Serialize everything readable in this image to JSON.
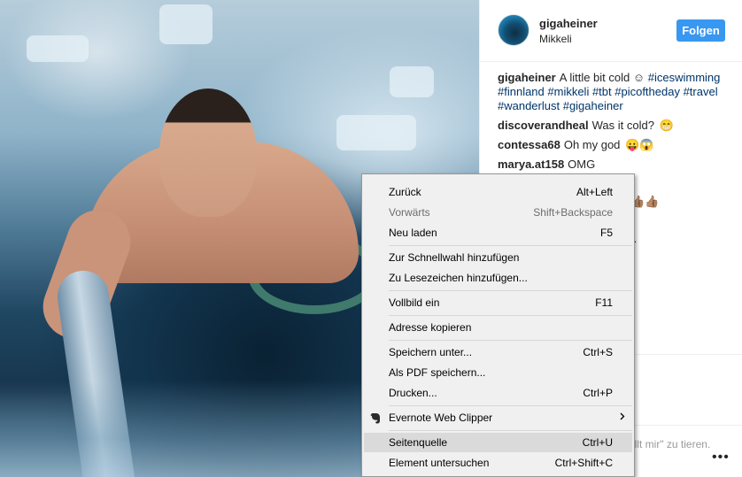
{
  "post": {
    "username": "gigaheiner",
    "location": "Mikkeli",
    "follow_label": "Folgen",
    "caption": {
      "user": "gigaheiner",
      "text": "A little bit cold ☺",
      "hashtags_line1": "#iceswimming",
      "hashtags_line2": "#finnland #mikkeli #tbt #picoftheday #travel",
      "hashtags_line3": "#wanderlust #gigaheiner"
    },
    "comments": [
      {
        "user": "discoverandheal",
        "text": "Was it cold?",
        "emoji": "😁"
      },
      {
        "user": "contessa68",
        "text": "Oh my god",
        "emoji": "😛😱"
      },
      {
        "user": "marya.at158",
        "text": "OMG",
        "emoji": ""
      }
    ],
    "partial_comment_emoji": "👍🏽👍🏽",
    "partial_comment_text": "r.",
    "likes_hint": "ällt mir\" zu tieren.",
    "more_icon": "•••"
  },
  "context_menu": {
    "items": [
      {
        "label": "Zurück",
        "shortcut": "Alt+Left",
        "disabled": false
      },
      {
        "label": "Vorwärts",
        "shortcut": "Shift+Backspace",
        "disabled": true
      },
      {
        "label": "Neu laden",
        "shortcut": "F5",
        "disabled": false
      },
      {
        "label": "Zur Schnellwahl hinzufügen",
        "shortcut": "",
        "disabled": false
      },
      {
        "label": "Zu Lesezeichen hinzufügen...",
        "shortcut": "",
        "disabled": false
      },
      {
        "label": "Vollbild ein",
        "shortcut": "F11",
        "disabled": false
      },
      {
        "label": "Adresse kopieren",
        "shortcut": "",
        "disabled": false
      },
      {
        "label": "Speichern unter...",
        "shortcut": "Ctrl+S",
        "disabled": false
      },
      {
        "label": "Als PDF speichern...",
        "shortcut": "",
        "disabled": false
      },
      {
        "label": "Drucken...",
        "shortcut": "Ctrl+P",
        "disabled": false
      },
      {
        "label": "Evernote Web Clipper",
        "shortcut": "",
        "icon": "evernote-elephant-icon",
        "submenu": true
      },
      {
        "label": "Seitenquelle",
        "shortcut": "Ctrl+U",
        "highlighted": true
      },
      {
        "label": "Element untersuchen",
        "shortcut": "Ctrl+Shift+C",
        "disabled": false
      }
    ]
  },
  "colors": {
    "follow_button": "#3897f0",
    "hashtag": "#003569",
    "menu_background": "#f0f0f0",
    "menu_highlight": "#dadada"
  }
}
